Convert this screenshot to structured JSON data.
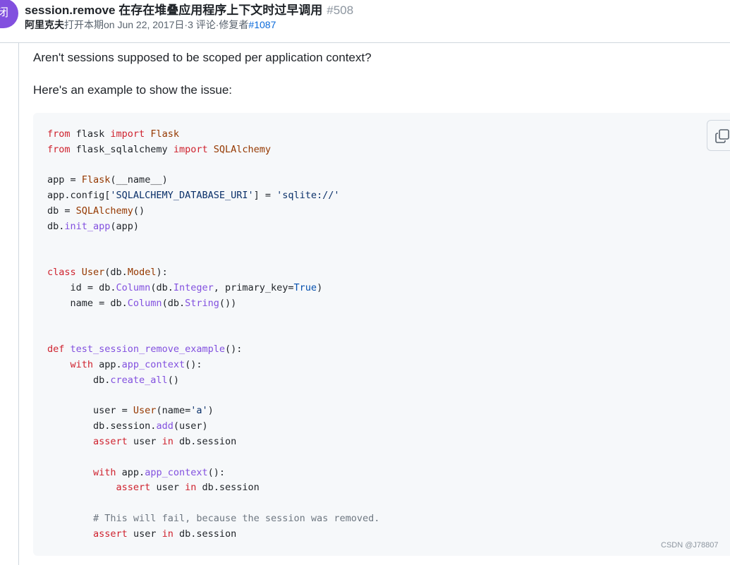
{
  "issue": {
    "state_label": "闭",
    "title": "session.remove 在存在堆叠应用程序上下文时过早调用",
    "number": "#508",
    "meta": {
      "author": "阿里克夫",
      "opened_text": "打开本期on Jun 22, 2017",
      "comments_text": "日·3 评论·修复者",
      "fixed_by": "#1087"
    }
  },
  "comment": {
    "paragraph1": "Aren't sessions supposed to be scoped per application context?",
    "paragraph2": "Here's an example to show the issue:"
  },
  "code_lines": [
    [
      [
        "kw",
        "from"
      ],
      [
        "t",
        " flask "
      ],
      [
        "kw",
        "import"
      ],
      [
        "t",
        " "
      ],
      [
        "cls",
        "Flask"
      ]
    ],
    [
      [
        "kw",
        "from"
      ],
      [
        "t",
        " flask_sqlalchemy "
      ],
      [
        "kw",
        "import"
      ],
      [
        "t",
        " "
      ],
      [
        "cls",
        "SQLAlchemy"
      ]
    ],
    [],
    [
      [
        "t",
        "app = "
      ],
      [
        "cls",
        "Flask"
      ],
      [
        "t",
        "(__name__)"
      ]
    ],
    [
      [
        "t",
        "app.config["
      ],
      [
        "str",
        "'SQLALCHEMY_DATABASE_URI'"
      ],
      [
        "t",
        "] = "
      ],
      [
        "str",
        "'sqlite://'"
      ]
    ],
    [
      [
        "t",
        "db = "
      ],
      [
        "cls",
        "SQLAlchemy"
      ],
      [
        "t",
        "()"
      ]
    ],
    [
      [
        "t",
        "db."
      ],
      [
        "fn",
        "init_app"
      ],
      [
        "t",
        "(app)"
      ]
    ],
    [],
    [],
    [
      [
        "kw",
        "class"
      ],
      [
        "t",
        " "
      ],
      [
        "cls",
        "User"
      ],
      [
        "t",
        "(db."
      ],
      [
        "cls",
        "Model"
      ],
      [
        "t",
        "):"
      ]
    ],
    [
      [
        "t",
        "    id = db."
      ],
      [
        "fn",
        "Column"
      ],
      [
        "t",
        "(db."
      ],
      [
        "fn",
        "Integer"
      ],
      [
        "t",
        ", primary_key="
      ],
      [
        "num",
        "True"
      ],
      [
        "t",
        ")"
      ]
    ],
    [
      [
        "t",
        "    name = db."
      ],
      [
        "fn",
        "Column"
      ],
      [
        "t",
        "(db."
      ],
      [
        "fn",
        "String"
      ],
      [
        "t",
        "())"
      ]
    ],
    [],
    [],
    [
      [
        "kw",
        "def"
      ],
      [
        "t",
        " "
      ],
      [
        "fn",
        "test_session_remove_example"
      ],
      [
        "t",
        "():"
      ]
    ],
    [
      [
        "t",
        "    "
      ],
      [
        "kw",
        "with"
      ],
      [
        "t",
        " app."
      ],
      [
        "fn",
        "app_context"
      ],
      [
        "t",
        "():"
      ]
    ],
    [
      [
        "t",
        "        db."
      ],
      [
        "fn",
        "create_all"
      ],
      [
        "t",
        "()"
      ]
    ],
    [],
    [
      [
        "t",
        "        user = "
      ],
      [
        "cls",
        "User"
      ],
      [
        "t",
        "(name="
      ],
      [
        "str",
        "'a'"
      ],
      [
        "t",
        ")"
      ]
    ],
    [
      [
        "t",
        "        db.session."
      ],
      [
        "fn",
        "add"
      ],
      [
        "t",
        "(user)"
      ]
    ],
    [
      [
        "t",
        "        "
      ],
      [
        "kw",
        "assert"
      ],
      [
        "t",
        " user "
      ],
      [
        "kw",
        "in"
      ],
      [
        "t",
        " db.session"
      ]
    ],
    [],
    [
      [
        "t",
        "        "
      ],
      [
        "kw",
        "with"
      ],
      [
        "t",
        " app."
      ],
      [
        "fn",
        "app_context"
      ],
      [
        "t",
        "():"
      ]
    ],
    [
      [
        "t",
        "            "
      ],
      [
        "kw",
        "assert"
      ],
      [
        "t",
        " user "
      ],
      [
        "kw",
        "in"
      ],
      [
        "t",
        " db.session"
      ]
    ],
    [],
    [
      [
        "t",
        "        "
      ],
      [
        "cm",
        "# This will fail, because the session was removed."
      ]
    ],
    [
      [
        "t",
        "        "
      ],
      [
        "kw",
        "assert"
      ],
      [
        "t",
        " user "
      ],
      [
        "kw",
        "in"
      ],
      [
        "t",
        " db.session"
      ]
    ]
  ],
  "watermark": "CSDN @J78807",
  "icons": {
    "copy": "copy-icon"
  },
  "colors": {
    "accent": "#8250df",
    "link": "#0969da",
    "keyword": "#cf222e",
    "class": "#953800",
    "function": "#8250df"
  }
}
